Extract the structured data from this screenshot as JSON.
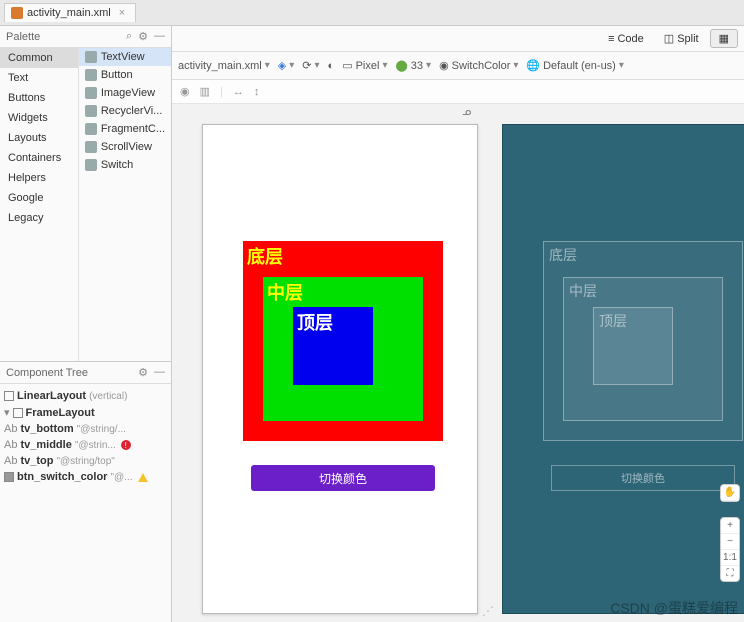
{
  "file_tab": "activity_main.xml",
  "view_modes": {
    "code": "Code",
    "split": "Split",
    "design": ""
  },
  "palette": {
    "title": "Palette",
    "categories": [
      "Common",
      "Text",
      "Buttons",
      "Widgets",
      "Layouts",
      "Containers",
      "Helpers",
      "Google",
      "Legacy"
    ],
    "components": [
      "TextView",
      "Button",
      "ImageView",
      "RecyclerVi...",
      "FragmentC...",
      "ScrollView",
      "Switch"
    ]
  },
  "component_tree": {
    "title": "Component Tree",
    "linear": "LinearLayout",
    "linear_hint": "(vertical)",
    "frame": "FrameLayout",
    "tv_bottom": "tv_bottom",
    "tv_bottom_hint": "\"@string/...",
    "tv_middle": "tv_middle",
    "tv_middle_hint": "\"@strin...",
    "tv_top": "tv_top",
    "tv_top_hint": "\"@string/top\"",
    "btn": "btn_switch_color",
    "btn_hint": "\"@..."
  },
  "toolbar": {
    "file": "activity_main.xml",
    "device": "Pixel",
    "api": "33",
    "theme": "SwitchColor",
    "locale": "Default (en-us)"
  },
  "preview": {
    "bottom_label": "底层",
    "middle_label": "中层",
    "top_label": "顶层",
    "button_label": "切换颜色",
    "colors": {
      "bottom": "#ff0000",
      "middle": "#00e000",
      "top": "#0000ee",
      "btn": "#6b1fc9"
    }
  },
  "zoom": {
    "plus": "+",
    "minus": "−",
    "fit": "1:1",
    "full": "⛶"
  },
  "watermark": "CSDN @蛋糕爱编程"
}
